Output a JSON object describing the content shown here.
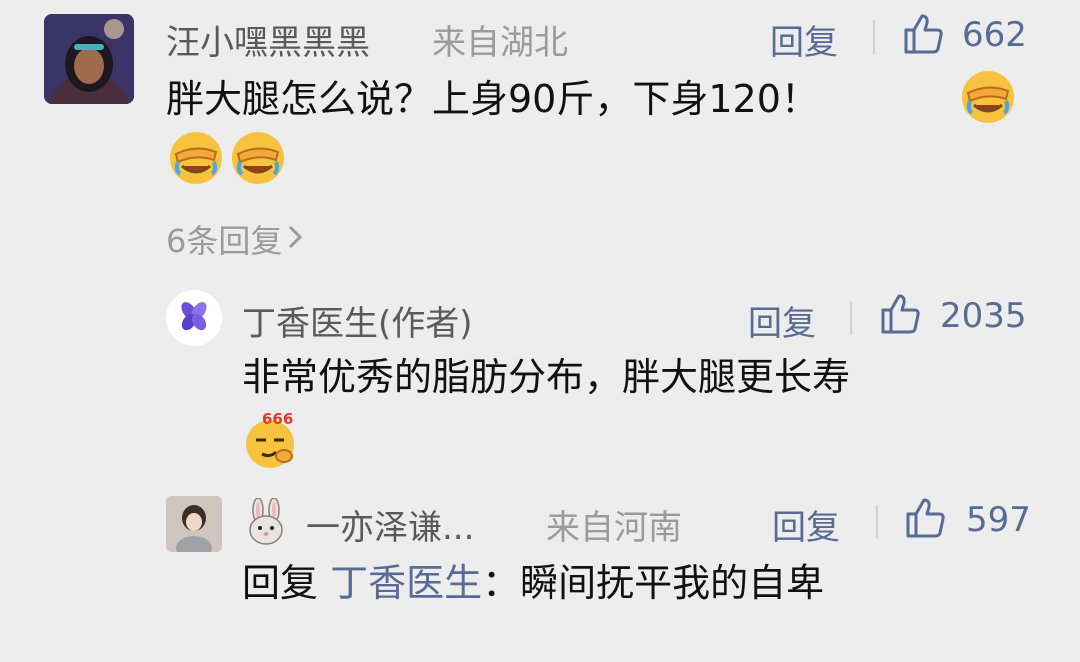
{
  "comment": {
    "author": "汪小嘿黑黑黑",
    "location": "来自湖北",
    "reply_label": "回复",
    "likes": "662",
    "text": "胖大腿怎么说？上身90斤，下身120！",
    "more_replies": "6条回复"
  },
  "replies": [
    {
      "author": "丁香医生(作者)",
      "reply_label": "回复",
      "likes": "2035",
      "text": "非常优秀的脂肪分布，胖大腿更长寿",
      "emoji_badge": "666"
    },
    {
      "author": "一亦泽谦...",
      "location": "来自河南",
      "reply_label": "回复",
      "likes": "597",
      "reply_prefix": "回复",
      "reply_to": "丁香医生",
      "text": "：瞬间抚平我的自卑"
    }
  ],
  "colors": {
    "background": "#ededed",
    "link_blue": "#576b95",
    "secondary_gray": "#9b9b9b",
    "brand_purple": "#6a4fd8"
  },
  "icons": [
    "thumbs-up-icon",
    "facepalm-emoji",
    "smirk-666-emoji",
    "rabbit-emoji",
    "chevron-right-icon",
    "clove-logo-icon"
  ]
}
